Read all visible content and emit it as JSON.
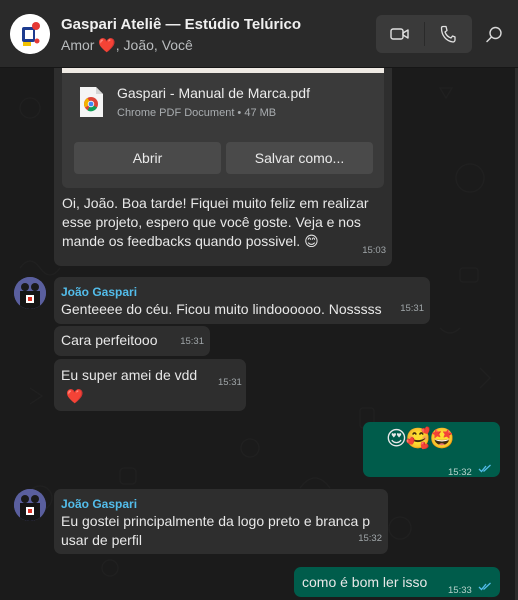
{
  "header": {
    "title": "Gaspari Ateliê — Estúdio Telúrico",
    "subtitle_prefix": "Amor",
    "subtitle_suffix": ", João, Você",
    "icons": [
      "video-call-icon",
      "voice-call-icon",
      "search-icon"
    ]
  },
  "document": {
    "name": "Gaspari - Manual de Marca.pdf",
    "meta": "Chrome PDF Document • 47 MB",
    "open_label": "Abrir",
    "save_label": "Salvar como...",
    "caption": "Oi, João. Boa tarde! Fiquei muito feliz em realizar esse projeto, espero que você goste. Veja e nos mande os feedbacks quando possivel.",
    "caption_emoji": "smile-emoji",
    "time": "15:03"
  },
  "messages": [
    {
      "sender": "João Gaspari",
      "text": "Genteeee do céu. Ficou muito lindoooooo. Nosssss",
      "time": "15:31"
    },
    {
      "text": "Cara perfeitooo",
      "time": "15:31"
    },
    {
      "text": "Eu super amei de vdd",
      "time": "15:31",
      "emoji": "red-heart-emoji"
    },
    {
      "outgoing": true,
      "emojis": [
        "heart-eyes-emoji",
        "smiling-hearts-emoji",
        "star-struck-emoji"
      ],
      "time": "15:32"
    },
    {
      "sender": "João Gaspari",
      "text_line1": "Eu gostei principalmente da logo preto e branca p",
      "text_line2": "usar de perfil",
      "time": "15:32"
    },
    {
      "outgoing": true,
      "text": "como é bom ler isso",
      "time": "15:33"
    }
  ],
  "colors": {
    "header_bg": "#2a2a2a",
    "chat_bg": "#1b1b1b",
    "incoming_bubble": "#2e2e2e",
    "outgoing_bubble": "#005c4b",
    "sender_name": "#53bdeb",
    "read_ticks": "#53bdeb"
  }
}
